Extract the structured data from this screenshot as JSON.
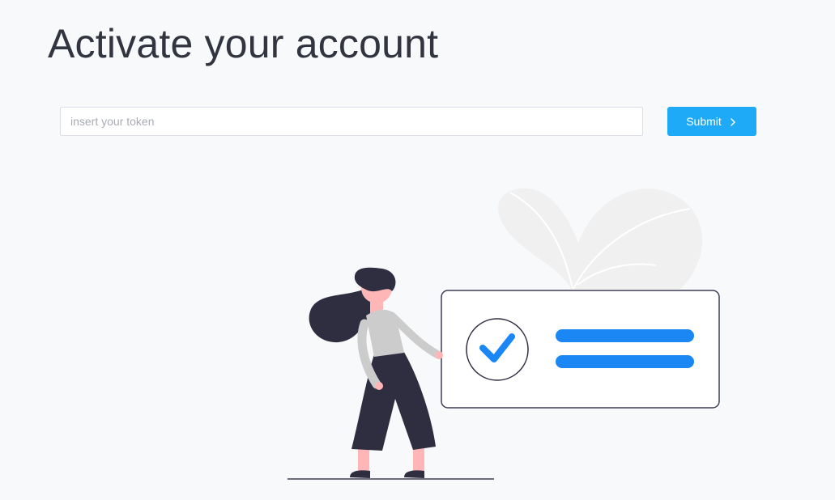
{
  "page": {
    "title": "Activate your account"
  },
  "form": {
    "token_placeholder": "insert your token",
    "token_value": "",
    "submit_label": "Submit"
  },
  "icons": {
    "submit_icon": "chevron-right-icon",
    "illustration": "woman-presenting-verified-card"
  },
  "colors": {
    "accent": "#1eaaf7",
    "check_blue": "#1a87f5",
    "dark": "#2f2e41",
    "skin": "#ffb6b6",
    "shirt": "#cccccc",
    "leaf": "#f0f0f0",
    "background": "#f8f9fb"
  }
}
